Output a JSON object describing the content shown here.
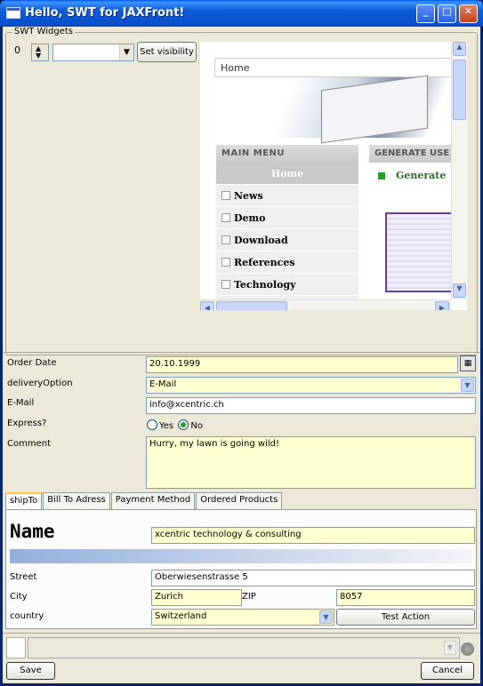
{
  "window": {
    "title": "Hello, SWT for JAXFront!"
  },
  "widgets": {
    "group_label": "SWT Widgets",
    "spinner_value": "0",
    "combo_value": "",
    "set_visibility_label": "Set visibility"
  },
  "browser": {
    "address_text": "Home",
    "menu_header": "MAIN MENU",
    "menu_items": [
      "Home",
      "News",
      "Demo",
      "Download",
      "References",
      "Technology"
    ],
    "right_header": "GENERATE USE",
    "right_link": "Generate"
  },
  "form": {
    "order_date": {
      "label": "Order Date",
      "value": "20.10.1999"
    },
    "delivery": {
      "label": "deliveryOption",
      "value": "E-Mail"
    },
    "email": {
      "label": "E-Mail",
      "value": "info@xcentric.ch"
    },
    "express": {
      "label": "Express?",
      "yes": "Yes",
      "no": "No",
      "selected": "No"
    },
    "comment": {
      "label": "Comment",
      "value": "Hurry, my lawn is going wild!"
    }
  },
  "tabs": [
    "shipTo",
    "Bill To Adress",
    "Payment Method",
    "Ordered Products"
  ],
  "active_tab": "shipTo",
  "shipto": {
    "name_label": "Name",
    "name_value": "xcentric technology & consulting",
    "street_label": "Street",
    "street_value": "Oberwiesenstrasse 5",
    "city_label": "City",
    "city_value": "Zurich",
    "zip_label": "ZIP",
    "zip_value": "8057",
    "country_label": "country",
    "country_value": "Switzerland",
    "test_action_label": "Test Action"
  },
  "footer": {
    "save_label": "Save",
    "cancel_label": "Cancel"
  },
  "colors": {
    "required_field_bg": "#ffffd2",
    "titlebar_blue": "#0a4fcc"
  }
}
